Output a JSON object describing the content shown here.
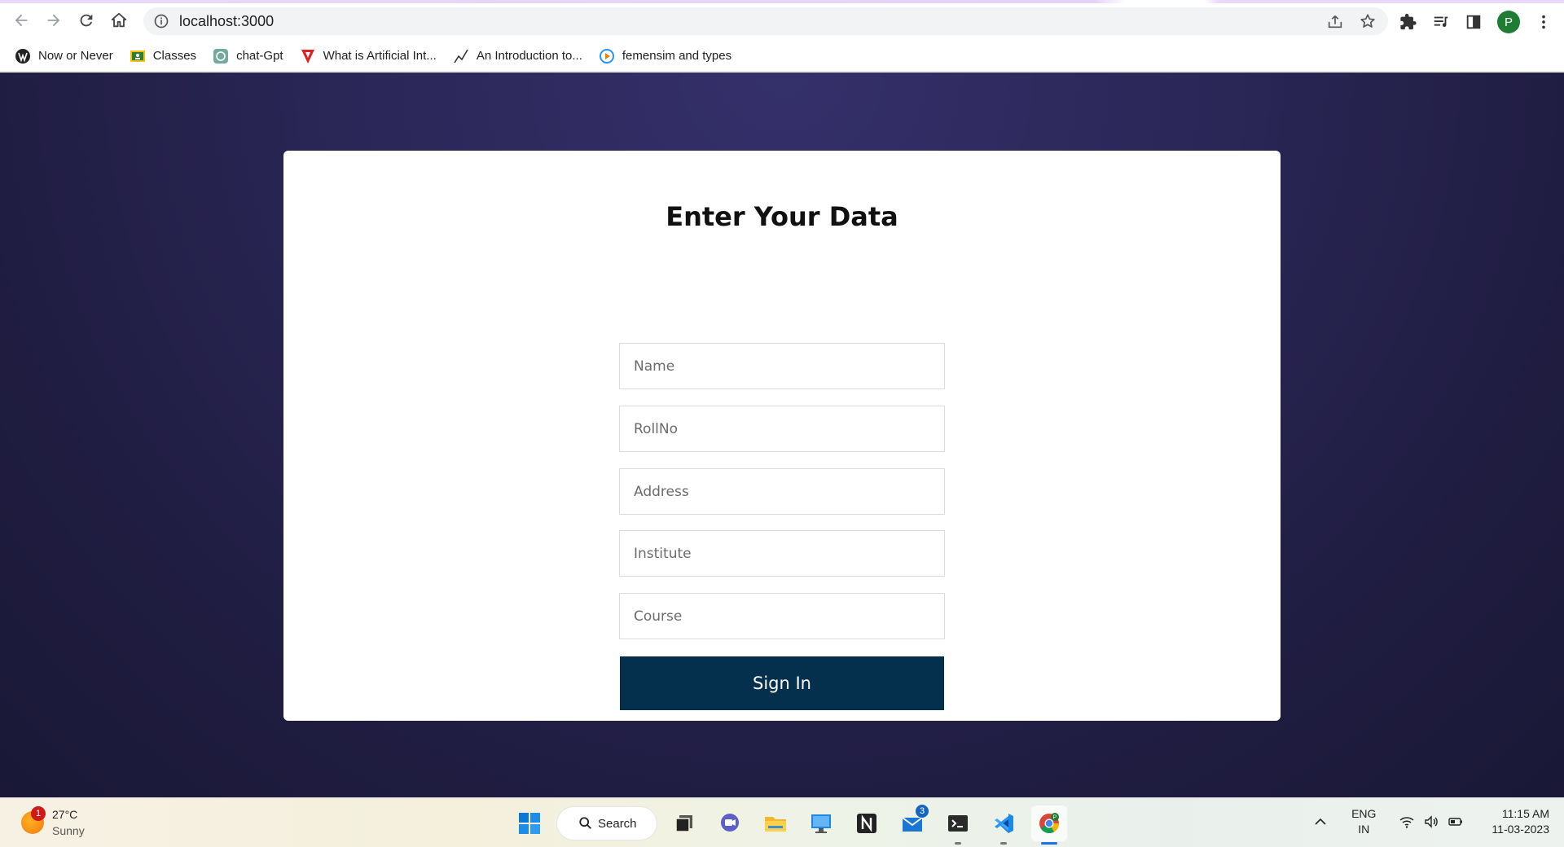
{
  "browser": {
    "url": "localhost:3000",
    "profile_initial": "P"
  },
  "bookmarks": [
    {
      "label": "Now or Never",
      "icon": "wordpress-icon"
    },
    {
      "label": "Classes",
      "icon": "classroom-icon"
    },
    {
      "label": "chat-Gpt",
      "icon": "openai-icon"
    },
    {
      "label": "What is Artificial Int...",
      "icon": "red-v-icon"
    },
    {
      "label": "An Introduction to...",
      "icon": "chart-line-icon"
    },
    {
      "label": "femensim and types",
      "icon": "play-circle-icon"
    }
  ],
  "form": {
    "title": "Enter Your Data",
    "fields": {
      "name": "Name",
      "rollno": "RollNo",
      "address": "Address",
      "institute": "Institute",
      "course": "Course"
    },
    "submit_label": "Sign In"
  },
  "taskbar": {
    "weather_temp": "27°C",
    "weather_condition": "Sunny",
    "weather_badge": "1",
    "search_label": "Search",
    "mail_badge": "3",
    "lang_line1": "ENG",
    "lang_line2": "IN",
    "time": "11:15 AM",
    "date": "11-03-2023"
  },
  "colors": {
    "page_bg": "#2a2656",
    "button": "#05304d"
  }
}
